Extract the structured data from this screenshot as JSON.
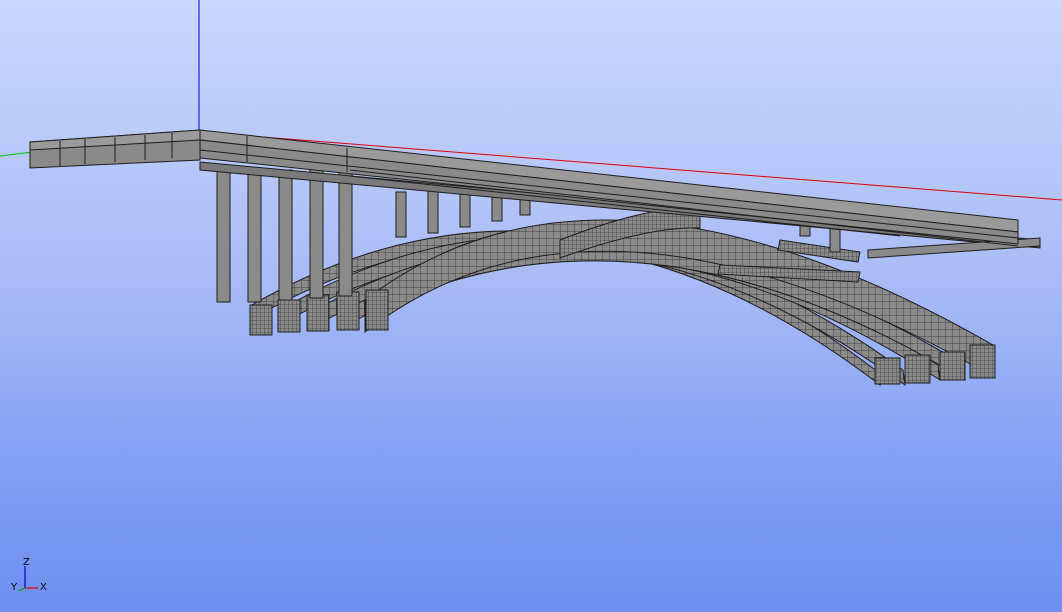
{
  "viewer": {
    "background_top": "#cbd8fd",
    "background_bottom": "#6e8ff0"
  },
  "model": {
    "name": "arch-bridge-mesh",
    "surface_color": "#8a8a8a",
    "edge_color": "#1e1e1e"
  },
  "global_axes": {
    "x_color": "#e00000",
    "y_color": "#00c000",
    "z_color": "#0000e0"
  },
  "triad": {
    "z_label": "Z",
    "y_label": "Y",
    "x_label": "X",
    "x_color": "#e00000",
    "y_color": "#00a000",
    "z_color": "#0000d0"
  }
}
